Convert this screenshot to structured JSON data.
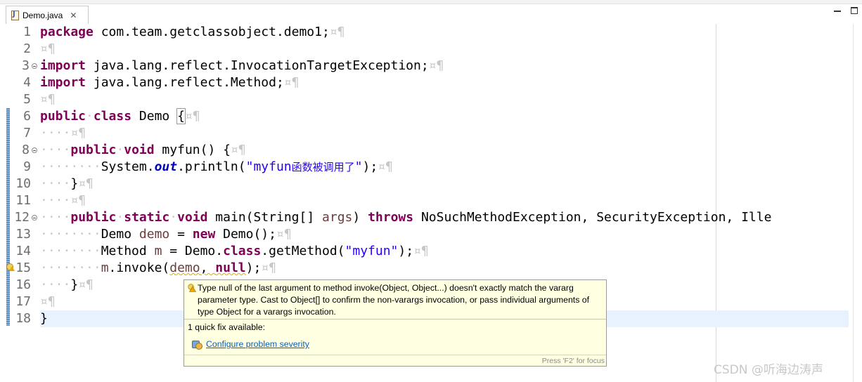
{
  "tab": {
    "title": "Demo.java"
  },
  "line_numbers": [
    "1",
    "2",
    "3",
    "4",
    "5",
    "6",
    "7",
    "8",
    "9",
    "10",
    "11",
    "12",
    "13",
    "14",
    "15",
    "16",
    "17",
    "18"
  ],
  "code": {
    "l1": {
      "kw": "package",
      "rest": " com.team.getclassobject.demo1;",
      "pm": "¤¶"
    },
    "l2": {
      "pm": "¤¶"
    },
    "l3": {
      "kw": "import",
      "rest": " java.lang.reflect.InvocationTargetException;",
      "pm": "¤¶"
    },
    "l4": {
      "kw": "import",
      "rest": " java.lang.reflect.Method;",
      "pm": "¤¶"
    },
    "l5": {
      "pm": "¤¶"
    },
    "l6": {
      "kw1": "public",
      "kw2": "class",
      "name": " Demo ",
      "brace": "{",
      "pm": "¤¶"
    },
    "l7": {
      "ws": "····",
      "pm": "¤¶"
    },
    "l8": {
      "ws": "····",
      "kw1": "public",
      "kw2": "void",
      "rest": " myfun() {",
      "pm": "¤¶"
    },
    "l9": {
      "ws": "········",
      "a": "System.",
      "fld": "out",
      "b": ".println(",
      "str_a": "\"myfun",
      "str_cjk": "函数被调用了",
      "str_b": "\"",
      "c": ");",
      "pm": "¤¶"
    },
    "l10": {
      "ws": "····",
      "rest": "}",
      "pm": "¤¶"
    },
    "l11": {
      "ws": "····",
      "pm": "¤¶"
    },
    "l12": {
      "ws": "····",
      "kw1": "public",
      "kw2": "static",
      "kw3": "void",
      "a": " main(String[] ",
      "var": "args",
      "b": ") ",
      "kw4": "throws",
      "c": " NoSuchMethodException, SecurityException, Ille"
    },
    "l13": {
      "ws": "········",
      "a": "Demo ",
      "var": "demo",
      "b": " = ",
      "kw": "new",
      "c": " Demo();",
      "pm": "¤¶"
    },
    "l14": {
      "ws": "········",
      "a": "Method ",
      "var": "m",
      "b": " = Demo.",
      "kw": "class",
      "c": ".getMethod(",
      "str": "\"myfun\"",
      "d": ");",
      "pm": "¤¶"
    },
    "l15": {
      "ws": "········",
      "var1": "m",
      "a": ".invoke(",
      "var2": "demo",
      "b": ", ",
      "kw": "null",
      "c": ");",
      "pm": "¤¶"
    },
    "l16": {
      "ws": "····",
      "rest": "}",
      "pm": "¤¶"
    },
    "l17": {
      "pm": "¤¶"
    },
    "l18": {
      "rest": "}"
    }
  },
  "tooltip": {
    "message": "Type null of the last argument to method invoke(Object, Object...) doesn't exactly match the vararg parameter type. Cast to Object[] to confirm the non-varargs invocation, or pass individual arguments of type Object for a varargs invocation.",
    "quick_fix_count": "1 quick fix available:",
    "fix_label": "Configure problem severity",
    "footer": "Press 'F2' for focus"
  },
  "watermark": "CSDN @听海边涛声",
  "colors": {
    "keyword": "#7f0055",
    "string": "#2a00ff",
    "static_field": "#0000c0",
    "local_var": "#6a3e3e",
    "current_line": "#e8f2fe",
    "tooltip_bg": "#ffffe1"
  }
}
